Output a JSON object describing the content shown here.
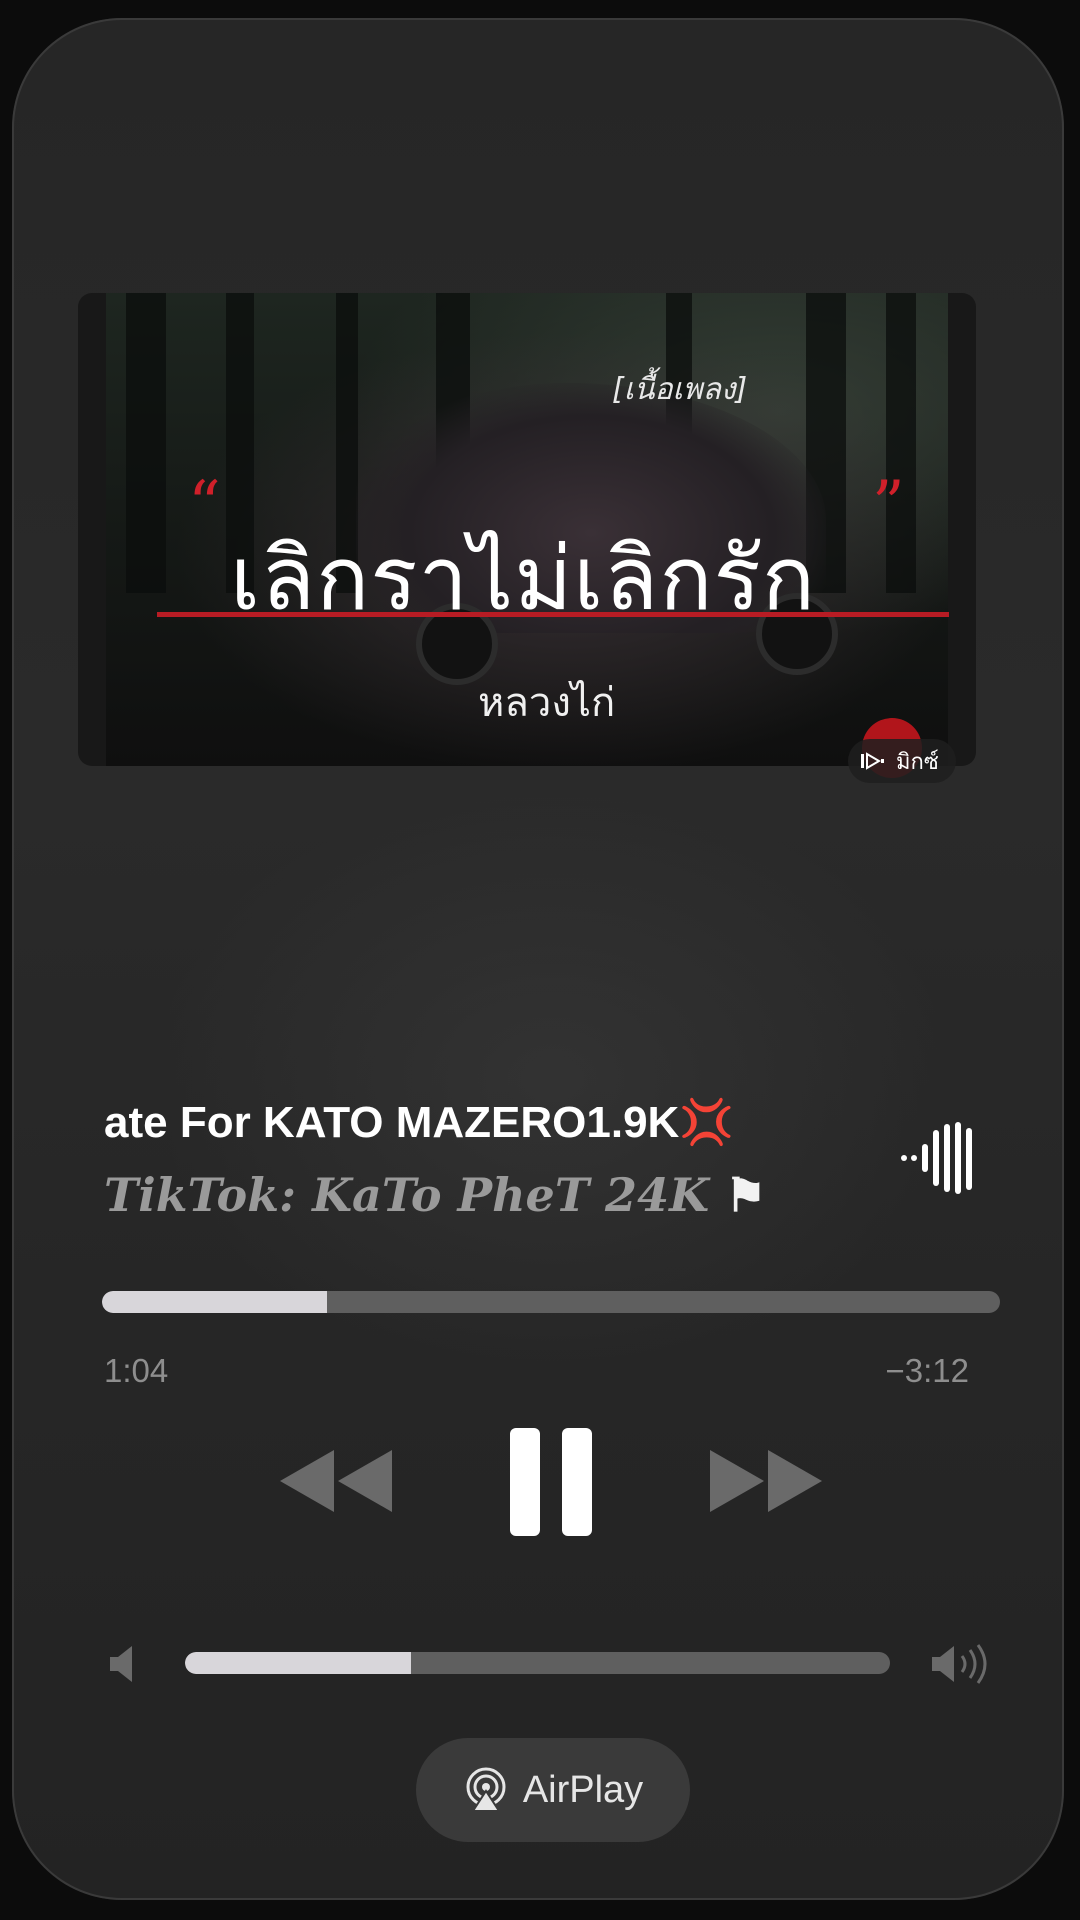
{
  "artwork": {
    "tag": "[เนื้อเพลง]",
    "title": "เลิกราไม่เลิกรัก",
    "artist_label": "หลวงไก่",
    "badge_label": "มิกซ์"
  },
  "track": {
    "title": "ate For KATO MAZERO1.9K",
    "title_emoji": "💢",
    "artist": "TikTok: KaTo PheT 24K",
    "artist_flag": "⚑"
  },
  "playback": {
    "elapsed": "1:04",
    "remaining": "−3:12",
    "progress_fraction": 0.25,
    "state": "playing"
  },
  "volume": {
    "level_fraction": 0.32
  },
  "airplay": {
    "label": "AirPlay"
  },
  "icons": {
    "wave": "audio-wave-icon",
    "rewind": "rewind-icon",
    "pause": "pause-icon",
    "forward": "fast-forward-icon",
    "volume_low": "speaker-low-icon",
    "volume_high": "speaker-high-icon",
    "airplay": "airplay-icon"
  }
}
